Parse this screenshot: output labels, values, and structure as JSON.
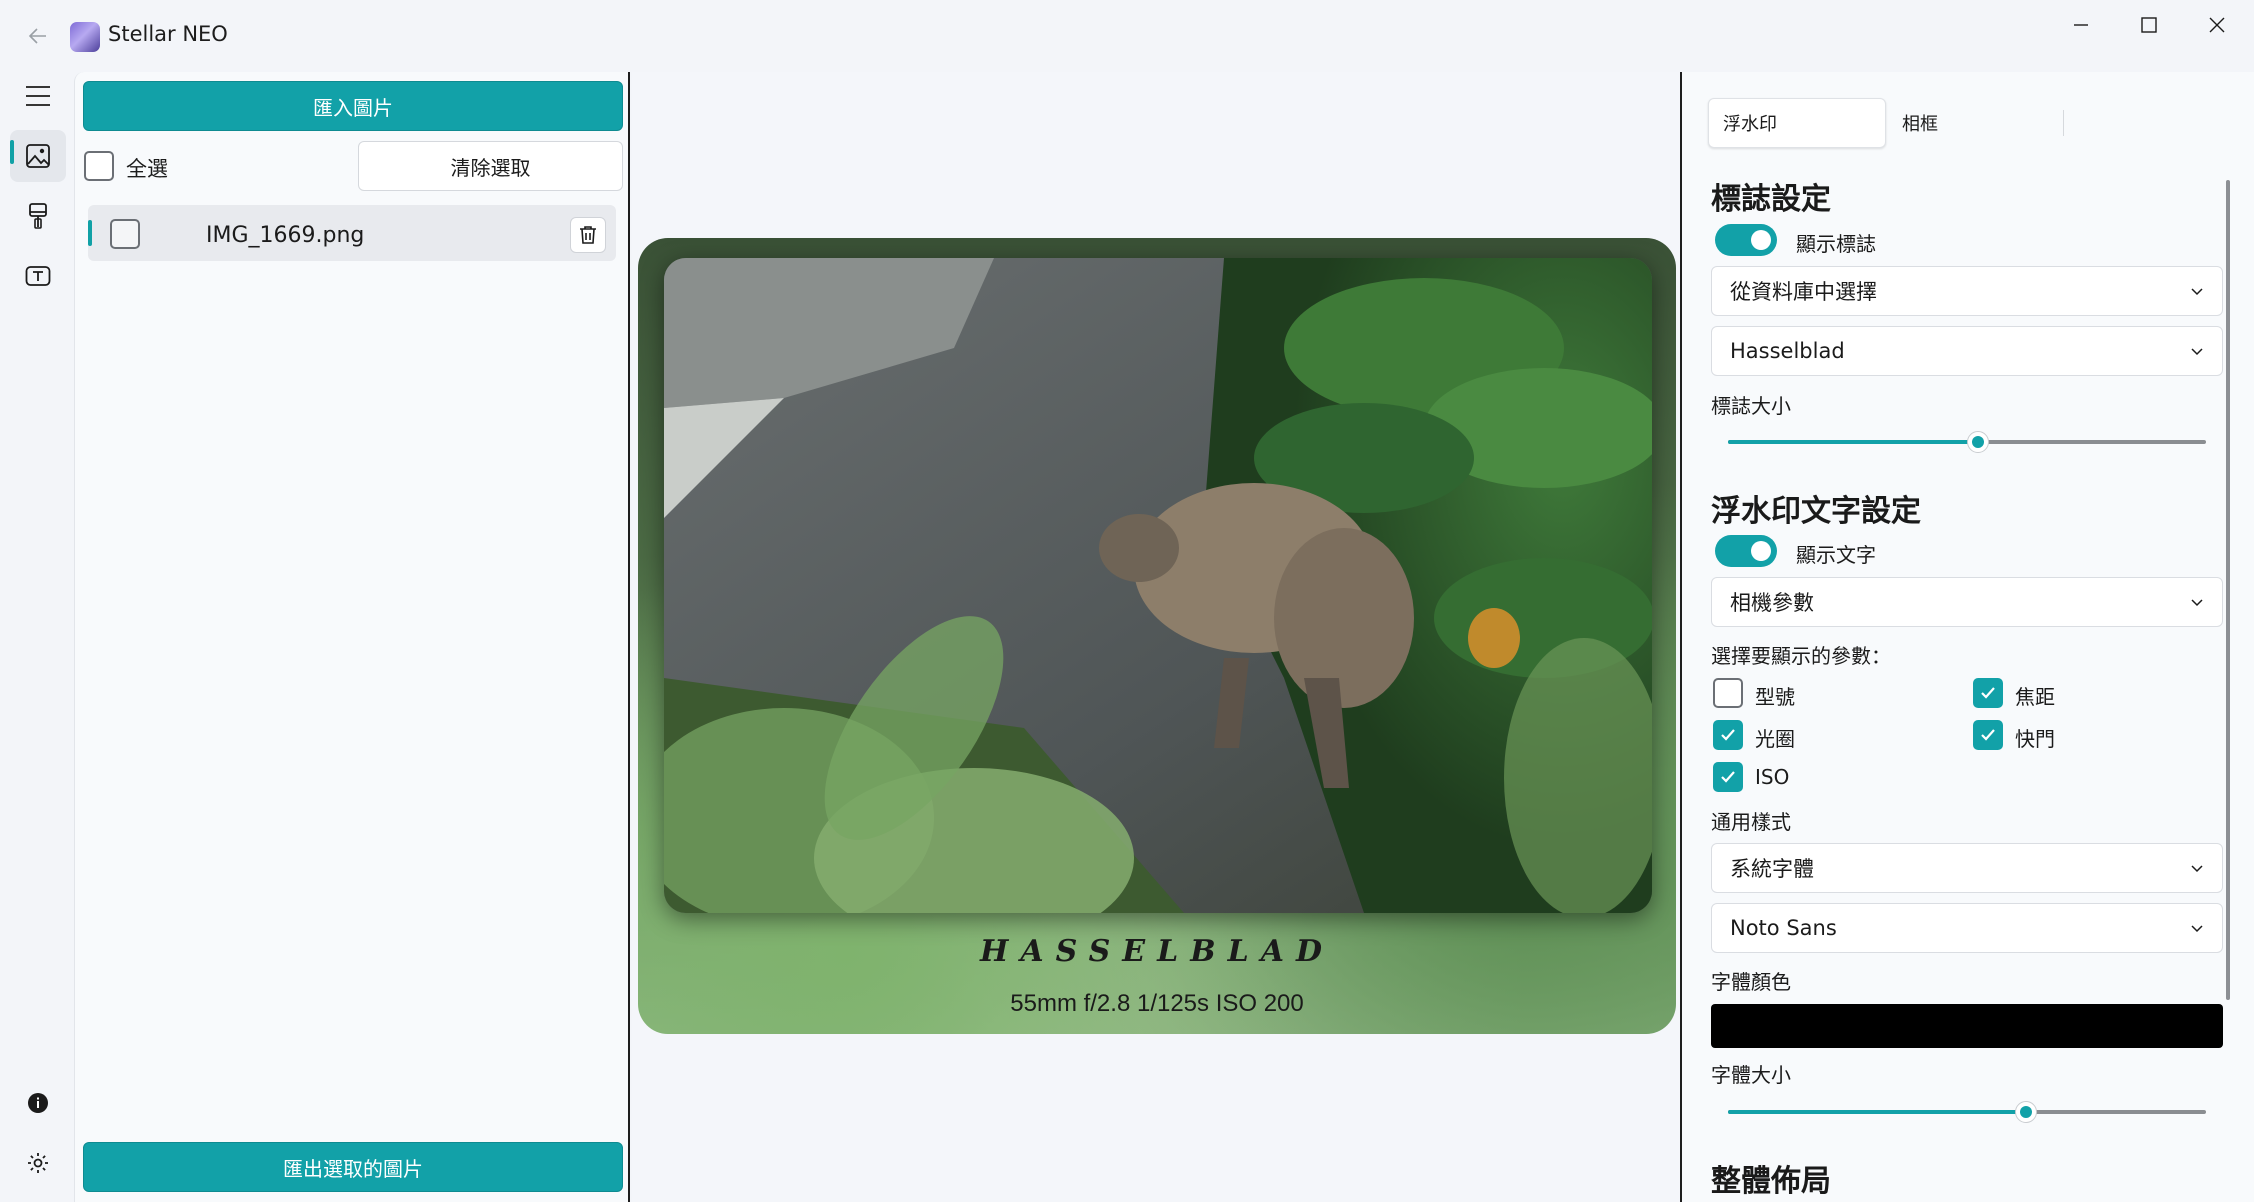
{
  "app": {
    "title": "Stellar NEO"
  },
  "colors": {
    "accent": "#12a1a8",
    "font_color": "#000000"
  },
  "rail": {
    "items": [
      {
        "icon": "menu-icon"
      },
      {
        "icon": "image-icon",
        "active": true
      },
      {
        "icon": "brush-icon"
      },
      {
        "icon": "text-box-icon"
      }
    ],
    "bottom": [
      {
        "icon": "info-icon"
      },
      {
        "icon": "gear-icon"
      }
    ]
  },
  "files": {
    "import_label": "匯入圖片",
    "select_all_label": "全選",
    "clear_selection_label": "清除選取",
    "items": [
      {
        "name": "IMG_1669.png",
        "checked": false
      }
    ],
    "export_label": "匯出選取的圖片"
  },
  "preview": {
    "brand": "HASSELBLAD",
    "params": "55mm  f/2.8  1/125s  ISO 200"
  },
  "settings": {
    "tabs": [
      {
        "label": "浮水印",
        "active": true
      },
      {
        "label": "相框",
        "active": false
      }
    ],
    "logo": {
      "title": "標誌設定",
      "show_label": "顯示標誌",
      "show": true,
      "source_value": "從資料庫中選擇",
      "logo_value": "Hasselblad",
      "size_label": "標誌大小",
      "size_fraction": 0.52
    },
    "text": {
      "title": "浮水印文字設定",
      "show_label": "顯示文字",
      "show": true,
      "content_value": "相機參數",
      "params_label": "選擇要顯示的參數：",
      "params": [
        {
          "label": "型號",
          "checked": false
        },
        {
          "label": "焦距",
          "checked": true
        },
        {
          "label": "光圈",
          "checked": true
        },
        {
          "label": "快門",
          "checked": true
        },
        {
          "label": "ISO",
          "checked": true
        }
      ],
      "style_label": "通用樣式",
      "font_source_value": "系統字體",
      "font_value": "Noto Sans",
      "font_color_label": "字體顏色",
      "font_size_label": "字體大小",
      "font_size_fraction": 0.62
    },
    "layout": {
      "title": "整體佈局"
    }
  }
}
